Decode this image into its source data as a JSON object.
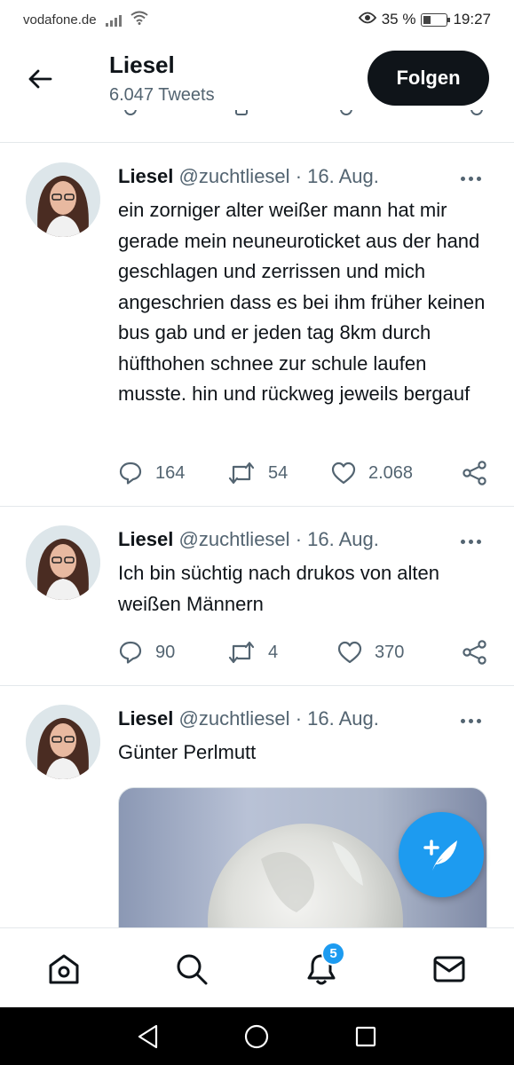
{
  "status_bar": {
    "carrier": "vodafone.de",
    "battery": "35 %",
    "battery_fraction": 0.35,
    "time": "19:27"
  },
  "header": {
    "name": "Liesel",
    "tweet_count": "6.047 Tweets",
    "follow_label": "Folgen"
  },
  "tweets": [
    {
      "name": "Liesel",
      "handle": "@zuchtliesel",
      "date": "· 16. Aug.",
      "text": "ein zorniger alter weißer mann hat mir gerade mein neuneuroticket aus der hand geschlagen und zerrissen und mich angeschrien dass es bei ihm früher keinen bus gab und er jeden tag 8km durch hüfthohen schnee zur schule laufen musste. hin und rückweg jeweils bergauf",
      "replies": "164",
      "retweets": "54",
      "likes": "2.068"
    },
    {
      "name": "Liesel",
      "handle": "@zuchtliesel",
      "date": "· 16. Aug.",
      "text": "Ich bin süchtig nach drukos von alten weißen Männern",
      "replies": "90",
      "retweets": "4",
      "likes": "370"
    },
    {
      "name": "Liesel",
      "handle": "@zuchtliesel",
      "date": "· 16. Aug.",
      "text": "Günter Perlmutt"
    }
  ],
  "bottom_nav": {
    "notification_badge": "5"
  },
  "colors": {
    "accent": "#1d9bf0",
    "text": "#0f1419",
    "secondary": "#536471",
    "follow_bg": "#0f1419"
  },
  "icons": [
    "back-arrow-icon",
    "more-icon",
    "reply-icon",
    "retweet-icon",
    "like-icon",
    "share-icon",
    "compose-icon",
    "home-icon",
    "search-icon",
    "bell-icon",
    "mail-icon"
  ]
}
